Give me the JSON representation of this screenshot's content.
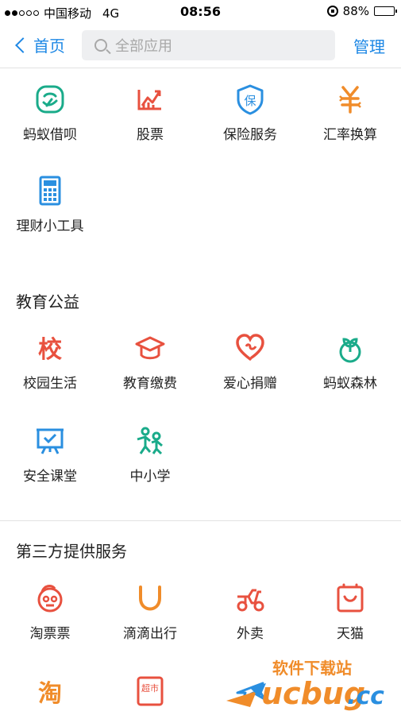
{
  "status_bar": {
    "carrier": "中国移动",
    "network": "4G",
    "time": "08:56",
    "battery": "88%",
    "battery_level": 0.88
  },
  "nav": {
    "back_label": "首页",
    "search_placeholder": "全部应用",
    "manage_label": "管理"
  },
  "finance_apps": [
    {
      "label": "蚂蚁借呗",
      "icon": "huabei-face-icon",
      "color": "#1aab8a"
    },
    {
      "label": "股票",
      "icon": "stock-chart-icon",
      "color": "#e8513f"
    },
    {
      "label": "保险服务",
      "icon": "insurance-shield-icon",
      "color": "#2a8fe0"
    },
    {
      "label": "汇率换算",
      "icon": "exchange-yen-icon",
      "color": "#f08c2a"
    },
    {
      "label": "理财小工具",
      "icon": "calculator-icon",
      "color": "#2a8fe0"
    }
  ],
  "education": {
    "title": "教育公益",
    "apps": [
      {
        "label": "校园生活",
        "icon": "campus-icon",
        "glyph": "校",
        "color": "#e8513f"
      },
      {
        "label": "教育缴费",
        "icon": "graduation-cap-icon",
        "color": "#e8513f"
      },
      {
        "label": "爱心捐赠",
        "icon": "heart-icon",
        "color": "#e8513f"
      },
      {
        "label": "蚂蚁森林",
        "icon": "sprout-icon",
        "color": "#1aab8a"
      },
      {
        "label": "安全课堂",
        "icon": "presentation-board-icon",
        "color": "#2a8fe0"
      },
      {
        "label": "中小学",
        "icon": "kids-icon",
        "color": "#1aab8a"
      }
    ]
  },
  "third_party": {
    "title": "第三方提供服务",
    "apps": [
      {
        "label": "淘票票",
        "icon": "taopiaopiao-icon",
        "color": "#e8513f"
      },
      {
        "label": "滴滴出行",
        "icon": "didi-icon",
        "color": "#f08c2a"
      },
      {
        "label": "外卖",
        "icon": "delivery-scooter-icon",
        "color": "#e8513f"
      },
      {
        "label": "天猫",
        "icon": "tmall-bag-icon",
        "color": "#e8513f"
      }
    ],
    "partial_row": [
      {
        "icon": "taobao-icon",
        "glyph": "淘",
        "color": "#f08c2a"
      },
      {
        "icon": "supermarket-icon",
        "glyph": "超市",
        "color": "#e8513f"
      },
      {
        "icon": "airplane-icon",
        "color": "#2a8fe0"
      },
      {
        "icon": "partial-icon",
        "color": "#2a8fe0"
      }
    ]
  },
  "watermark": {
    "title": "软件下载站",
    "brand": "ucbug",
    "suffix": ".cc"
  }
}
